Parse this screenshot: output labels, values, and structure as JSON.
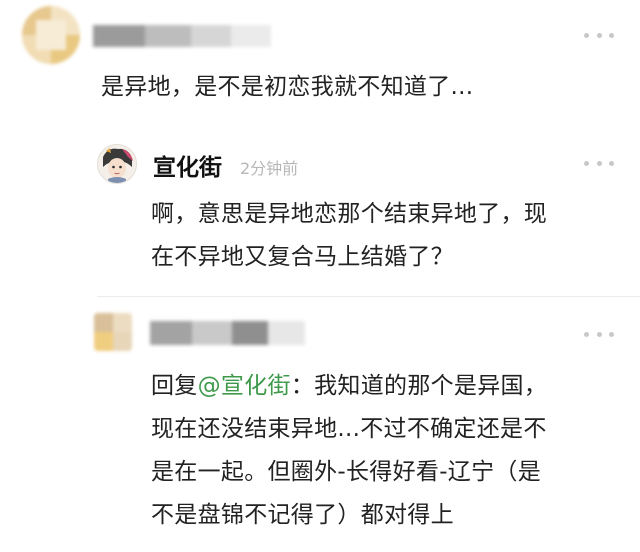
{
  "comments": [
    {
      "author": "",
      "text": "是异地，是不是初恋我就不知道了..."
    },
    {
      "author": "宣化街",
      "time": "2分钟前",
      "text_line1": "啊，意思是异地恋那个结束异地了，现",
      "text_line2": "在不异地又复合马上结婚了？"
    },
    {
      "author": "",
      "reply_prefix": "回复",
      "mention": "@宣化街",
      "colon": "：",
      "text_line1_rest": "我知道的那个是异国，",
      "text_line2": "现在还没结束异地...不过不确定还是不",
      "text_line3": "是在一起。但圈外-长得好看-辽宁（是",
      "text_line4": "不是盘锦不记得了）都对得上"
    }
  ],
  "icons": {
    "more": "more-dots-icon"
  },
  "colors": {
    "mention": "#3e9a4a",
    "time": "#b7b7b7",
    "dots": "#c8c8c8"
  }
}
